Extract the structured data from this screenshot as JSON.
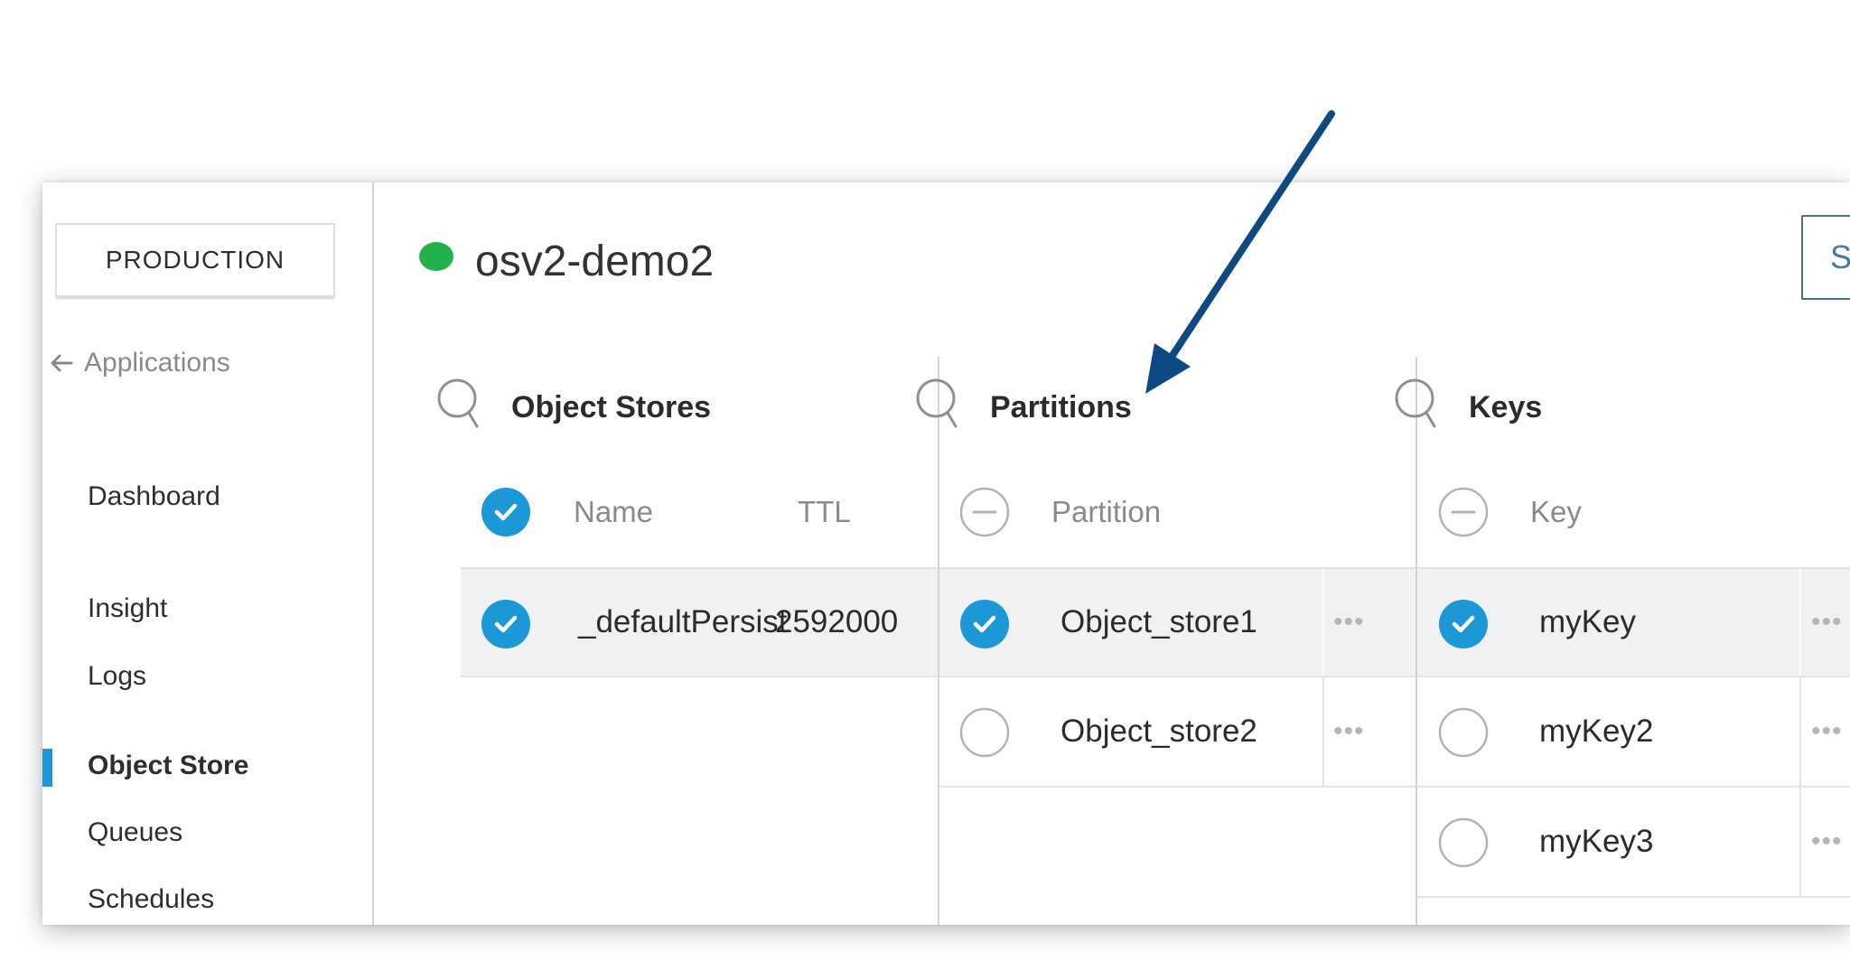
{
  "sidebar": {
    "environment": "PRODUCTION",
    "back_label": "Applications",
    "items": [
      {
        "label": "Dashboard"
      },
      {
        "label": "Insight"
      },
      {
        "label": "Logs"
      },
      {
        "label": "Object Store"
      },
      {
        "label": "Queues"
      },
      {
        "label": "Schedules"
      }
    ],
    "active_item": "Object Store"
  },
  "header": {
    "app_name": "osv2-demo2",
    "status": "running",
    "status_color": "#22b14c",
    "button_label": "Show"
  },
  "columns": {
    "object_stores": {
      "title": "Object Stores",
      "header_name": "Name",
      "header_ttl": "TTL",
      "rows": [
        {
          "name": "_defaultPersist",
          "ttl": "2592000",
          "checked": true
        }
      ]
    },
    "partitions": {
      "title": "Partitions",
      "header": "Partition",
      "rows": [
        {
          "name": "Object_store1",
          "checked": true
        },
        {
          "name": "Object_store2",
          "checked": false
        }
      ]
    },
    "keys": {
      "title": "Keys",
      "header": "Key",
      "rows": [
        {
          "name": "myKey",
          "checked": true
        },
        {
          "name": "myKey2",
          "checked": false
        },
        {
          "name": "myKey3",
          "checked": false
        }
      ]
    }
  },
  "more_glyph": "•••",
  "accent_color": "#1c98d6",
  "annotation_arrow_color": "#0e4a82",
  "icons": {
    "search": "search-icon",
    "checked": "checkmark-circle-icon",
    "unchecked": "empty-circle-icon",
    "deselect": "minus-circle-icon",
    "back": "arrow-left-icon",
    "more": "more-horizontal-icon"
  }
}
